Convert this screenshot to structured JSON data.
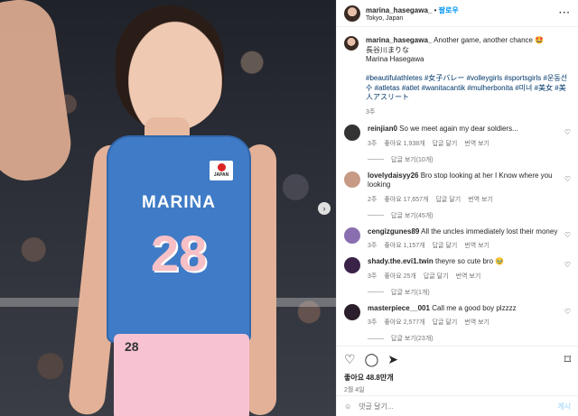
{
  "photo": {
    "jersey_name": "MARINA",
    "jersey_number": "28",
    "shorts_number": "28",
    "flag_text": "JAPAN"
  },
  "header": {
    "username": "marina_hasegawa_",
    "follow": "팔로우",
    "location": "Tokyo, Japan"
  },
  "caption": {
    "username": "marina_hasegawa_",
    "line1": "Another game, another chance",
    "line2": "長谷川まりな",
    "line3": "Marina Hasegawa",
    "hashtags": "#beautifulathletes #女子バレー #volleygirls #sportsgirls #운동선수 #atletas #atlet #wanitacantik #mulherbonita #미녀 #美女 #美人アスリート",
    "time": "3주"
  },
  "comments": [
    {
      "user": "reinjian0",
      "text": "So we meet again my dear soldiers...",
      "time": "3주",
      "likes": "좋아요 1,938개",
      "reply": "답글 달기",
      "translate": "번역 보기",
      "replies": "답글 보기(10개)"
    },
    {
      "user": "lovelydaisyy26",
      "text": "Bro stop looking at her I Know where you looking",
      "time": "2주",
      "likes": "좋아요 17,657개",
      "reply": "답글 달기",
      "translate": "번역 보기",
      "replies": "답글 보기(45개)"
    },
    {
      "user": "cengizgunes89",
      "text": "All the uncles immediately lost their money",
      "time": "3주",
      "likes": "좋아요 1,157개",
      "reply": "답글 달기",
      "translate": "번역 보기",
      "replies": ""
    },
    {
      "user": "shady.the.evi1.twin",
      "text": "theyre so cute bro",
      "time": "3주",
      "likes": "좋아요 25개",
      "reply": "답글 달기",
      "translate": "번역 보기",
      "replies": "답글 보기(1개)"
    },
    {
      "user": "masterpiece__001",
      "text": "Call me a good boy plzzzz",
      "time": "3주",
      "likes": "좋아요 2,577개",
      "reply": "답글 달기",
      "translate": "번역 보기",
      "replies": "답글 보기(23개)"
    }
  ],
  "actions": {
    "likes": "좋아요 48.8만개",
    "date": "2월 4일"
  },
  "comment_box": {
    "placeholder": "댓글 달기...",
    "post": "게시"
  },
  "icons": [
    "heart-icon",
    "comment-icon",
    "share-icon",
    "bookmark-icon",
    "more-icon",
    "emoji-icon",
    "chevron-right-icon"
  ]
}
